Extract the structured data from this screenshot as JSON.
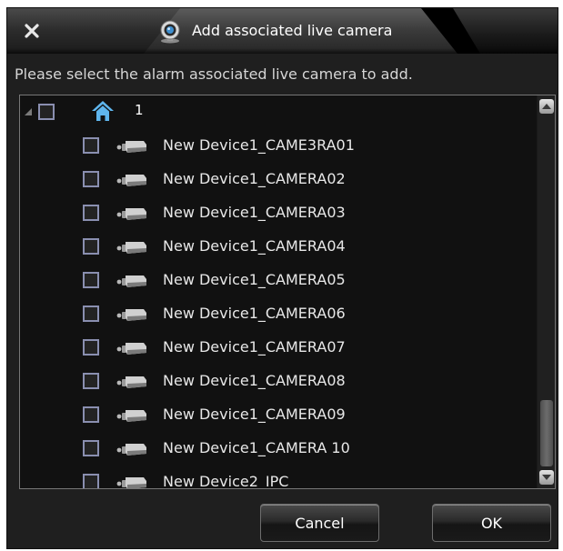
{
  "dialog": {
    "title": "Add associated live camera",
    "instruction": "Please select the alarm associated live camera to add."
  },
  "tree": {
    "root": {
      "label": "1",
      "checked": false,
      "expanded": true,
      "icon": "home-icon"
    },
    "items": [
      {
        "label": "New Device1_CAME3RA01",
        "checked": false,
        "icon": "camera-icon"
      },
      {
        "label": "New Device1_CAMERA02",
        "checked": false,
        "icon": "camera-icon"
      },
      {
        "label": "New Device1_CAMERA03",
        "checked": false,
        "icon": "camera-icon"
      },
      {
        "label": "New Device1_CAMERA04",
        "checked": false,
        "icon": "camera-icon"
      },
      {
        "label": "New Device1_CAMERA05",
        "checked": false,
        "icon": "camera-icon"
      },
      {
        "label": "New Device1_CAMERA06",
        "checked": false,
        "icon": "camera-icon"
      },
      {
        "label": "New Device1_CAMERA07",
        "checked": false,
        "icon": "camera-icon"
      },
      {
        "label": "New Device1_CAMERA08",
        "checked": false,
        "icon": "camera-icon"
      },
      {
        "label": "New Device1_CAMERA09",
        "checked": false,
        "icon": "camera-icon"
      },
      {
        "label": "New Device1_CAMERA 10",
        "checked": false,
        "icon": "camera-icon"
      },
      {
        "label": "New Device2_IPC",
        "checked": false,
        "icon": "camera-icon"
      }
    ],
    "scroll": {
      "thumb_start_fraction": 0.81,
      "thumb_size_fraction": 0.19
    }
  },
  "buttons": {
    "cancel_label": "Cancel",
    "ok_label": "OK"
  },
  "colors": {
    "background": "#1f1f1f",
    "tree_background": "#111111",
    "checkbox_border": "#8a8fb0",
    "home_icon": "#5fb6ee",
    "text": "#e8e8e8"
  }
}
